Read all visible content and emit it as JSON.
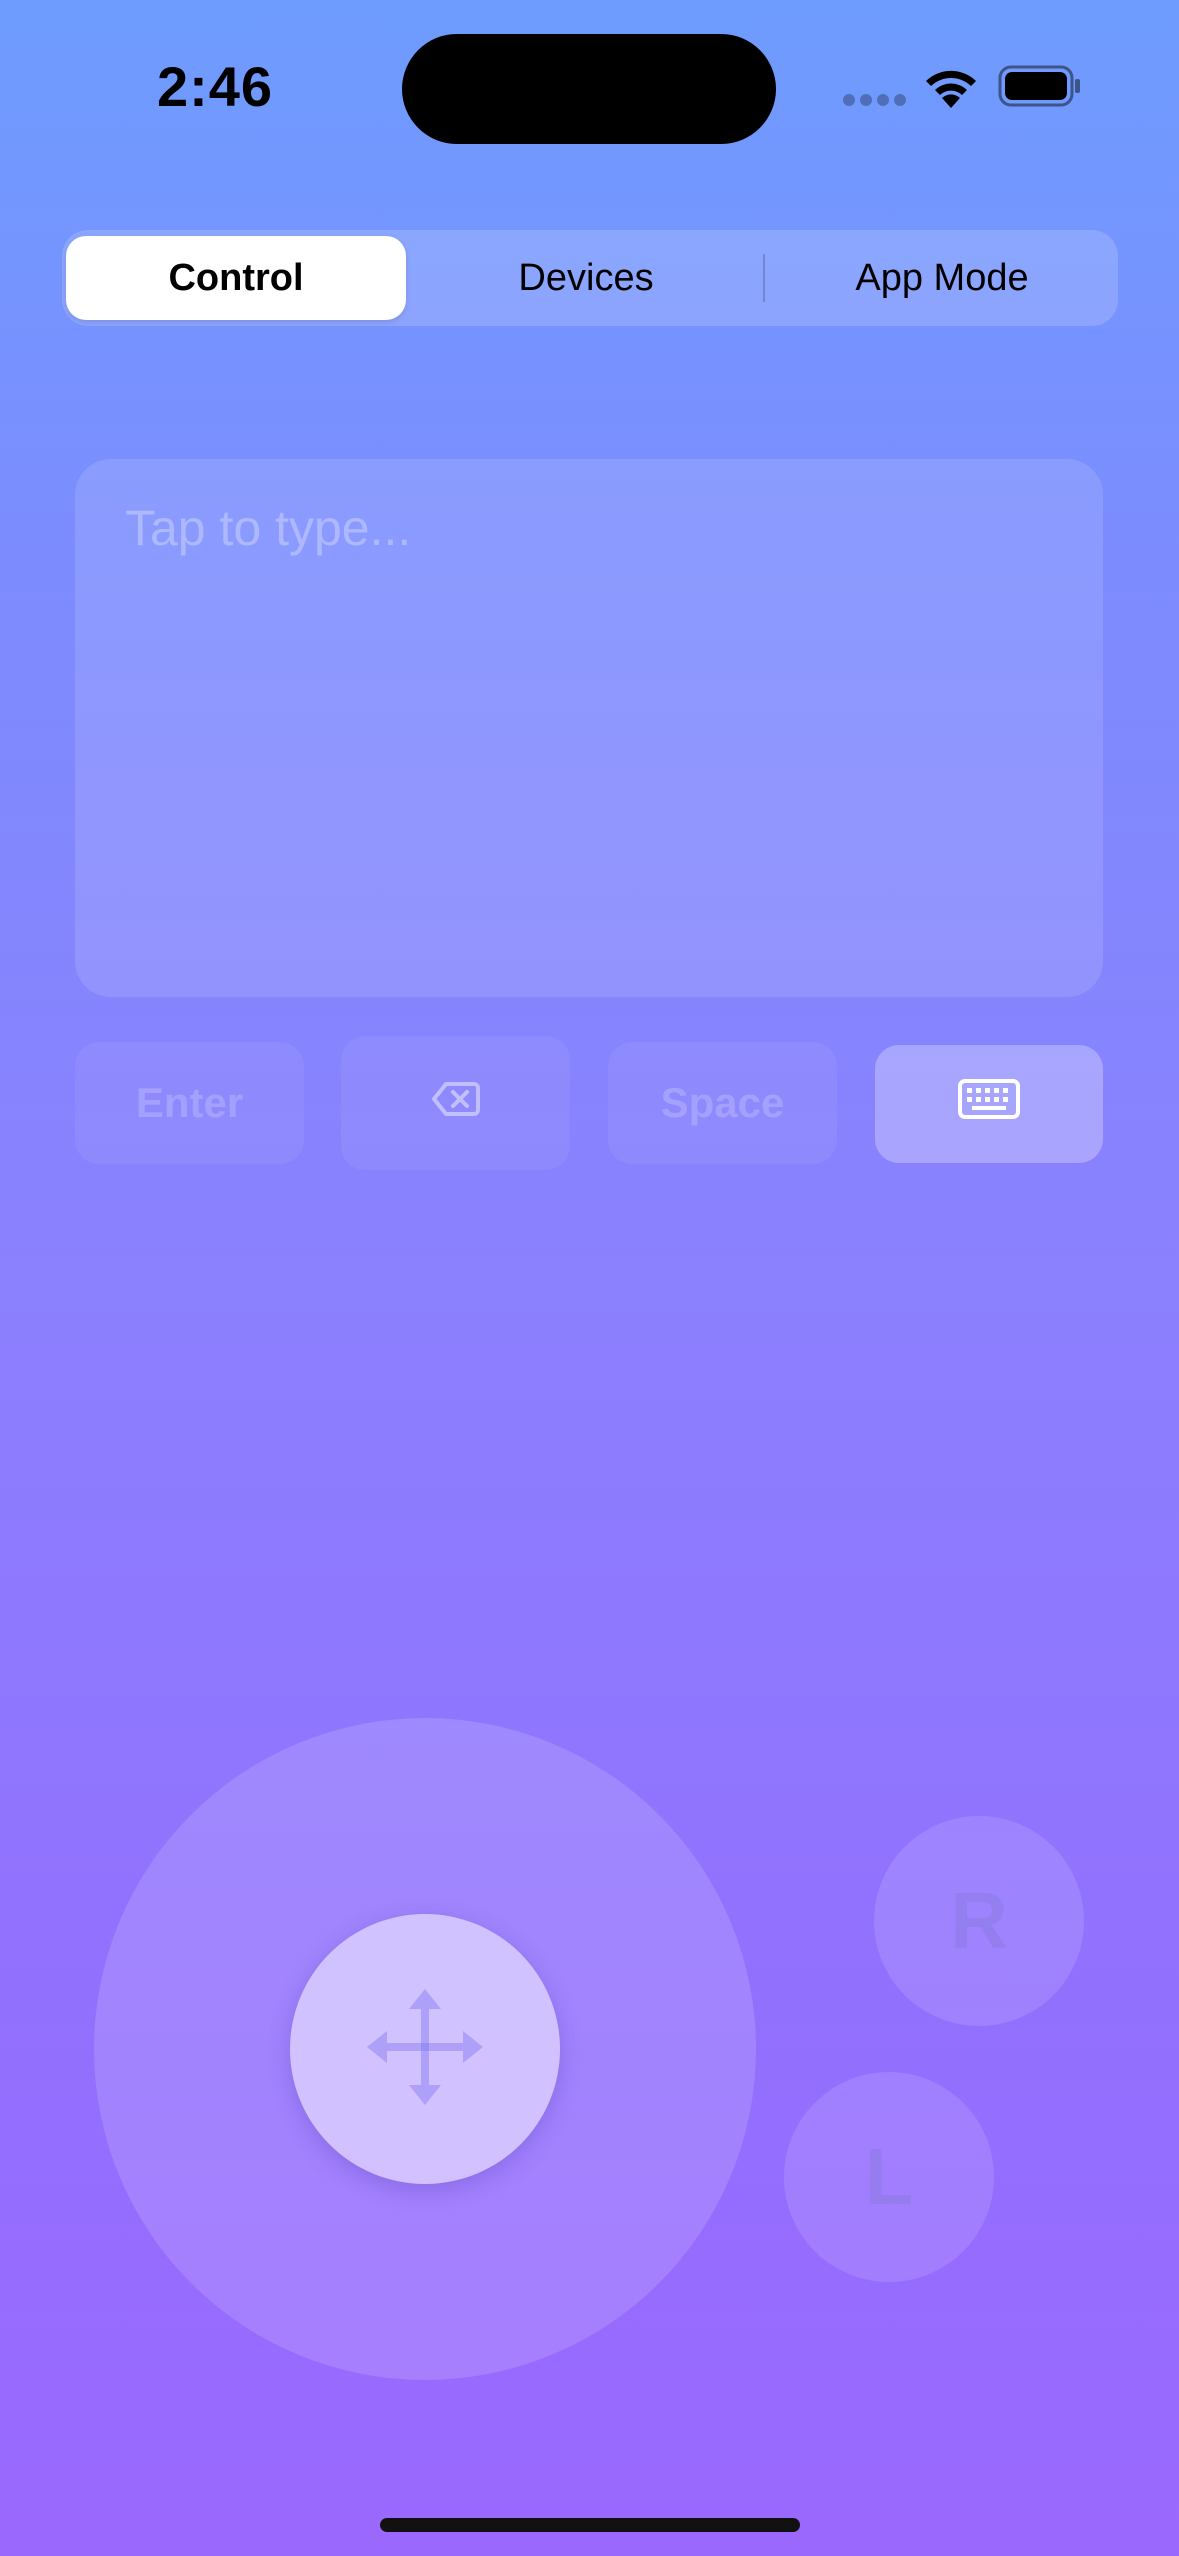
{
  "status_bar": {
    "time": "2:46",
    "icons": [
      "cellular-dots-icon",
      "wifi-icon",
      "battery-icon"
    ]
  },
  "segmented_control": {
    "tabs": [
      {
        "label": "Control",
        "selected": true
      },
      {
        "label": "Devices",
        "selected": false
      },
      {
        "label": "App Mode",
        "selected": false
      }
    ]
  },
  "text_input": {
    "placeholder": "Tap to type..."
  },
  "keys": {
    "enter_label": "Enter",
    "delete_icon": "delete-backward-icon",
    "space_label": "Space",
    "keyboard_icon": "keyboard-icon"
  },
  "joystick": {
    "icon": "move-arrows-icon"
  },
  "mouse_buttons": {
    "right_label": "R",
    "left_label": "L"
  },
  "colors": {
    "gradient_top": "#6e9cfe",
    "gradient_bottom": "#9a68fd",
    "selected_tab_bg": "#ffffff"
  }
}
